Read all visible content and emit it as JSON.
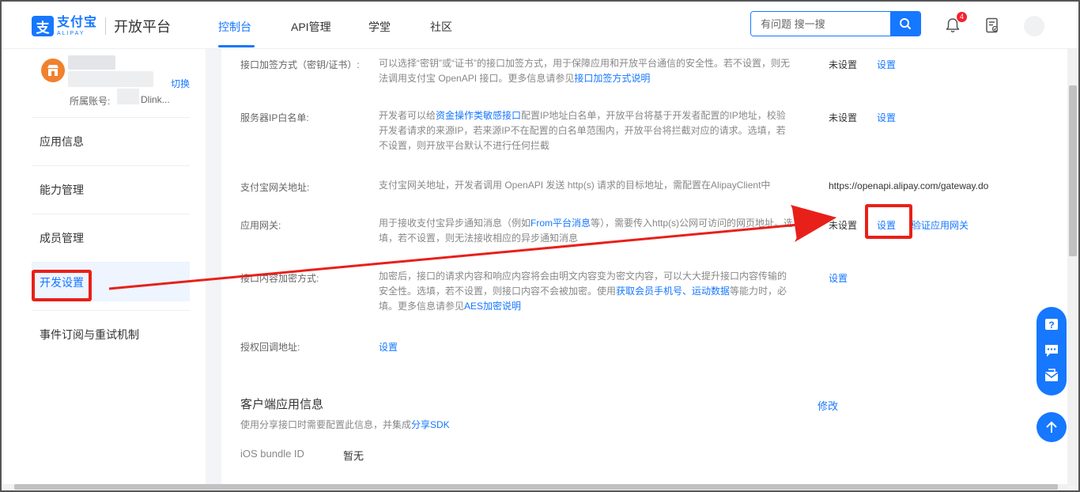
{
  "header": {
    "logo_mark": "支",
    "logo_cn": "支付宝",
    "logo_en": "ALIPAY",
    "platform": "开放平台",
    "nav": [
      "控制台",
      "API管理",
      "学堂",
      "社区"
    ],
    "search_placeholder": "有问题 搜一搜",
    "notification_count": "4"
  },
  "sidebar": {
    "switch_label": "切换",
    "account_label": "所属账号:",
    "account_suffix": "Dlink...",
    "items": [
      "应用信息",
      "能力管理",
      "成员管理",
      "开发设置",
      "事件订阅与重试机制"
    ],
    "active_index": 3
  },
  "main": {
    "rows": [
      {
        "label": "接口加签方式（密钥/证书）:",
        "desc_a": "可以选择“密钥”或“证书”的接口加签方式，用于保障应用和开放平台通信的安全性。若不设置，则无法调用支付宝 OpenAPI 接口。更多信息请参见",
        "desc_link": "接口加签方式说明",
        "status": "未设置",
        "action": "设置"
      },
      {
        "label": "服务器IP白名单:",
        "desc_a": "开发者可以给",
        "desc_link": "资金操作类敏感接口",
        "desc_b": "配置IP地址白名单，开放平台将基于开发者配置的IP地址，校验开发者请求的来源IP，若来源IP不在配置的白名单范围内，开放平台将拦截对应的请求。选填，若不设置，则开放平台默认不进行任何拦截",
        "status": "未设置",
        "action": "设置"
      },
      {
        "label": "支付宝网关地址:",
        "desc_a": "支付宝网关地址，开发者调用 OpenAPI 发送 http(s) 请求的目标地址，需配置在AlipayClient中",
        "value": "https://openapi.alipay.com/gateway.do"
      },
      {
        "label": "应用网关:",
        "desc_a": "用于接收支付宝异步通知消息（例如",
        "desc_link": "From平台消息",
        "desc_b": "等），需要传入http(s)公网可访问的网页地址。选填，若不设置，则无法接收相应的异步通知消息",
        "status": "未设置",
        "action": "设置",
        "action2": "验证应用网关"
      },
      {
        "label": "接口内容加密方式:",
        "desc_a": "加密后，接口的请求内容和响应内容将会由明文内容变为密文内容，可以大大提升接口内容传输的安全性。选填，若不设置，则接口内容不会被加密。使用",
        "desc_link": "获取会员手机号、运动数据",
        "desc_b": "等能力时，必填。更多信息请参见",
        "desc_link2": "AES加密说明",
        "action": "设置"
      },
      {
        "label": "授权回调地址:",
        "action": "设置"
      }
    ],
    "client_section": {
      "title": "客户端应用信息",
      "edit": "修改",
      "subtitle_a": "使用分享接口时需要配置此信息，并集成",
      "subtitle_link": "分享SDK",
      "ios_label": "iOS bundle ID",
      "ios_value": "暂无"
    }
  },
  "colors": {
    "primary": "#1677ff",
    "highlight_red": "#e8201a",
    "avatar_orange": "#f0812e"
  }
}
